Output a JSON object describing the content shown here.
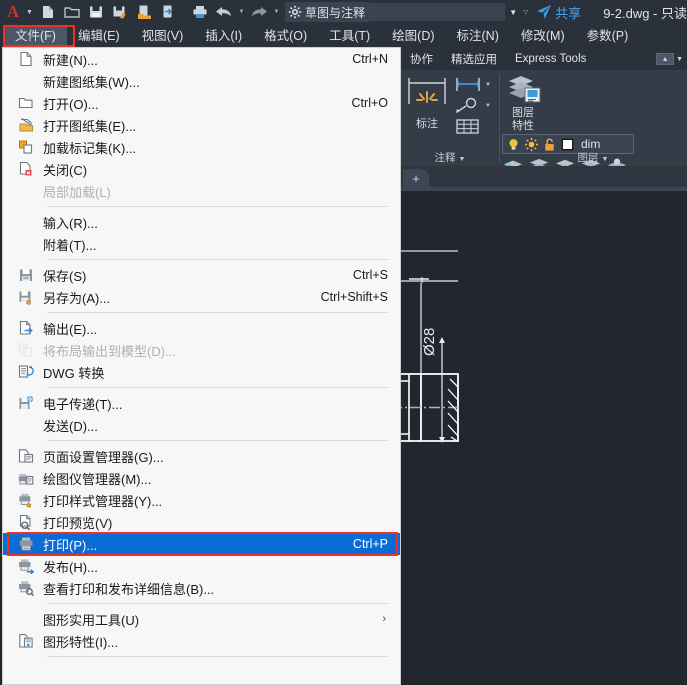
{
  "titlebar": {
    "app_logo": "A",
    "workspace": "草图与注释",
    "share_label": "共享",
    "document_title": "9-2.dwg - 只读",
    "quick_access": [
      {
        "name": "new-document-icon",
        "tip": "新建"
      },
      {
        "name": "open-folder-icon",
        "tip": "打开"
      },
      {
        "name": "save-icon",
        "tip": "保存"
      },
      {
        "name": "save-as-icon",
        "tip": "另存为"
      },
      {
        "name": "open-from-web-icon",
        "tip": "从 Web 打开"
      },
      {
        "name": "save-to-web-icon",
        "tip": "保存到 Web"
      },
      {
        "name": "plot-icon",
        "tip": "打印"
      },
      {
        "name": "undo-icon",
        "tip": "放弃"
      },
      {
        "name": "redo-icon",
        "tip": "重做"
      }
    ]
  },
  "menubar": {
    "items": [
      {
        "label": "文件(F)",
        "active": true
      },
      {
        "label": "编辑(E)",
        "active": false
      },
      {
        "label": "视图(V)",
        "active": false
      },
      {
        "label": "插入(I)",
        "active": false
      },
      {
        "label": "格式(O)",
        "active": false
      },
      {
        "label": "工具(T)",
        "active": false
      },
      {
        "label": "绘图(D)",
        "active": false
      },
      {
        "label": "标注(N)",
        "active": false
      },
      {
        "label": "修改(M)",
        "active": false
      },
      {
        "label": "参数(P)",
        "active": false
      }
    ]
  },
  "ribbon": {
    "tabs": [
      {
        "label": "协作"
      },
      {
        "label": "精选应用"
      },
      {
        "label": "Express Tools"
      }
    ],
    "panels": {
      "annotate": {
        "big_label": "标注",
        "footer": "注释"
      },
      "layers": {
        "prop_label_line1": "图层",
        "prop_label_line2": "特性",
        "current_layer": "dim",
        "footer": "图层"
      }
    }
  },
  "canvas": {
    "tab_plus": "+",
    "dimension_label": "Ø28"
  },
  "file_menu": {
    "items": [
      {
        "icon": "new-file-icon",
        "label": "新建(N)...",
        "shortcut": "Ctrl+N",
        "disabled": false,
        "selected": false,
        "submenu": false
      },
      {
        "icon": "none",
        "label": "新建图纸集(W)...",
        "shortcut": "",
        "disabled": false,
        "selected": false,
        "submenu": false
      },
      {
        "icon": "open-folder-icon",
        "label": "打开(O)...",
        "shortcut": "Ctrl+O",
        "disabled": false,
        "selected": false,
        "submenu": false
      },
      {
        "icon": "open-sheetset-icon",
        "label": "打开图纸集(E)...",
        "shortcut": "",
        "disabled": false,
        "selected": false,
        "submenu": false
      },
      {
        "icon": "load-markupset-icon",
        "label": "加载标记集(K)...",
        "shortcut": "",
        "disabled": false,
        "selected": false,
        "submenu": false
      },
      {
        "icon": "close-file-icon",
        "label": "关闭(C)",
        "shortcut": "",
        "disabled": false,
        "selected": false,
        "submenu": false
      },
      {
        "icon": "none",
        "label": "局部加载(L)",
        "shortcut": "",
        "disabled": true,
        "selected": false,
        "submenu": false
      },
      {
        "separator": true
      },
      {
        "icon": "none",
        "label": "输入(R)...",
        "shortcut": "",
        "disabled": false,
        "selected": false,
        "submenu": false
      },
      {
        "icon": "none",
        "label": "附着(T)...",
        "shortcut": "",
        "disabled": false,
        "selected": false,
        "submenu": false
      },
      {
        "separator": true
      },
      {
        "icon": "save-icon",
        "label": "保存(S)",
        "shortcut": "Ctrl+S",
        "disabled": false,
        "selected": false,
        "submenu": false
      },
      {
        "icon": "save-as-icon",
        "label": "另存为(A)...",
        "shortcut": "Ctrl+Shift+S",
        "disabled": false,
        "selected": false,
        "submenu": false
      },
      {
        "separator": true
      },
      {
        "icon": "export-icon",
        "label": "输出(E)...",
        "shortcut": "",
        "disabled": false,
        "selected": false,
        "submenu": false
      },
      {
        "icon": "export-layout-icon",
        "label": "将布局输出到模型(D)...",
        "shortcut": "",
        "disabled": true,
        "selected": false,
        "submenu": false
      },
      {
        "icon": "dwg-convert-icon",
        "label": "DWG 转换",
        "shortcut": "",
        "disabled": false,
        "selected": false,
        "submenu": false
      },
      {
        "separator": true
      },
      {
        "icon": "etransmit-icon",
        "label": "电子传递(T)...",
        "shortcut": "",
        "disabled": false,
        "selected": false,
        "submenu": false
      },
      {
        "icon": "none",
        "label": "发送(D)...",
        "shortcut": "",
        "disabled": false,
        "selected": false,
        "submenu": false
      },
      {
        "separator": true
      },
      {
        "icon": "page-setup-icon",
        "label": "页面设置管理器(G)...",
        "shortcut": "",
        "disabled": false,
        "selected": false,
        "submenu": false
      },
      {
        "icon": "plotter-manager-icon",
        "label": "绘图仪管理器(M)...",
        "shortcut": "",
        "disabled": false,
        "selected": false,
        "submenu": false
      },
      {
        "icon": "plotstyle-manager-icon",
        "label": "打印样式管理器(Y)...",
        "shortcut": "",
        "disabled": false,
        "selected": false,
        "submenu": false
      },
      {
        "icon": "plot-preview-icon",
        "label": "打印预览(V)",
        "shortcut": "",
        "disabled": false,
        "selected": false,
        "submenu": false
      },
      {
        "icon": "plot-icon",
        "label": "打印(P)...",
        "shortcut": "Ctrl+P",
        "disabled": false,
        "selected": true,
        "submenu": false
      },
      {
        "icon": "publish-icon",
        "label": "发布(H)...",
        "shortcut": "",
        "disabled": false,
        "selected": false,
        "submenu": false
      },
      {
        "icon": "view-plot-details-icon",
        "label": "查看打印和发布详细信息(B)...",
        "shortcut": "",
        "disabled": false,
        "selected": false,
        "submenu": false
      },
      {
        "separator": true
      },
      {
        "icon": "none",
        "label": "图形实用工具(U)",
        "shortcut": "",
        "disabled": false,
        "selected": false,
        "submenu": true
      },
      {
        "icon": "drawing-props-icon",
        "label": "图形特性(I)...",
        "shortcut": "",
        "disabled": false,
        "selected": false,
        "submenu": false
      },
      {
        "separator": true
      }
    ]
  },
  "colors": {
    "highlight_red": "#ef3124",
    "menu_selected_blue": "#0a6cd4",
    "ribbon_bg": "#343c47",
    "titlebar_bg": "#2b313a",
    "canvas_bg": "#22272f",
    "share_blue": "#4aa3e8"
  }
}
